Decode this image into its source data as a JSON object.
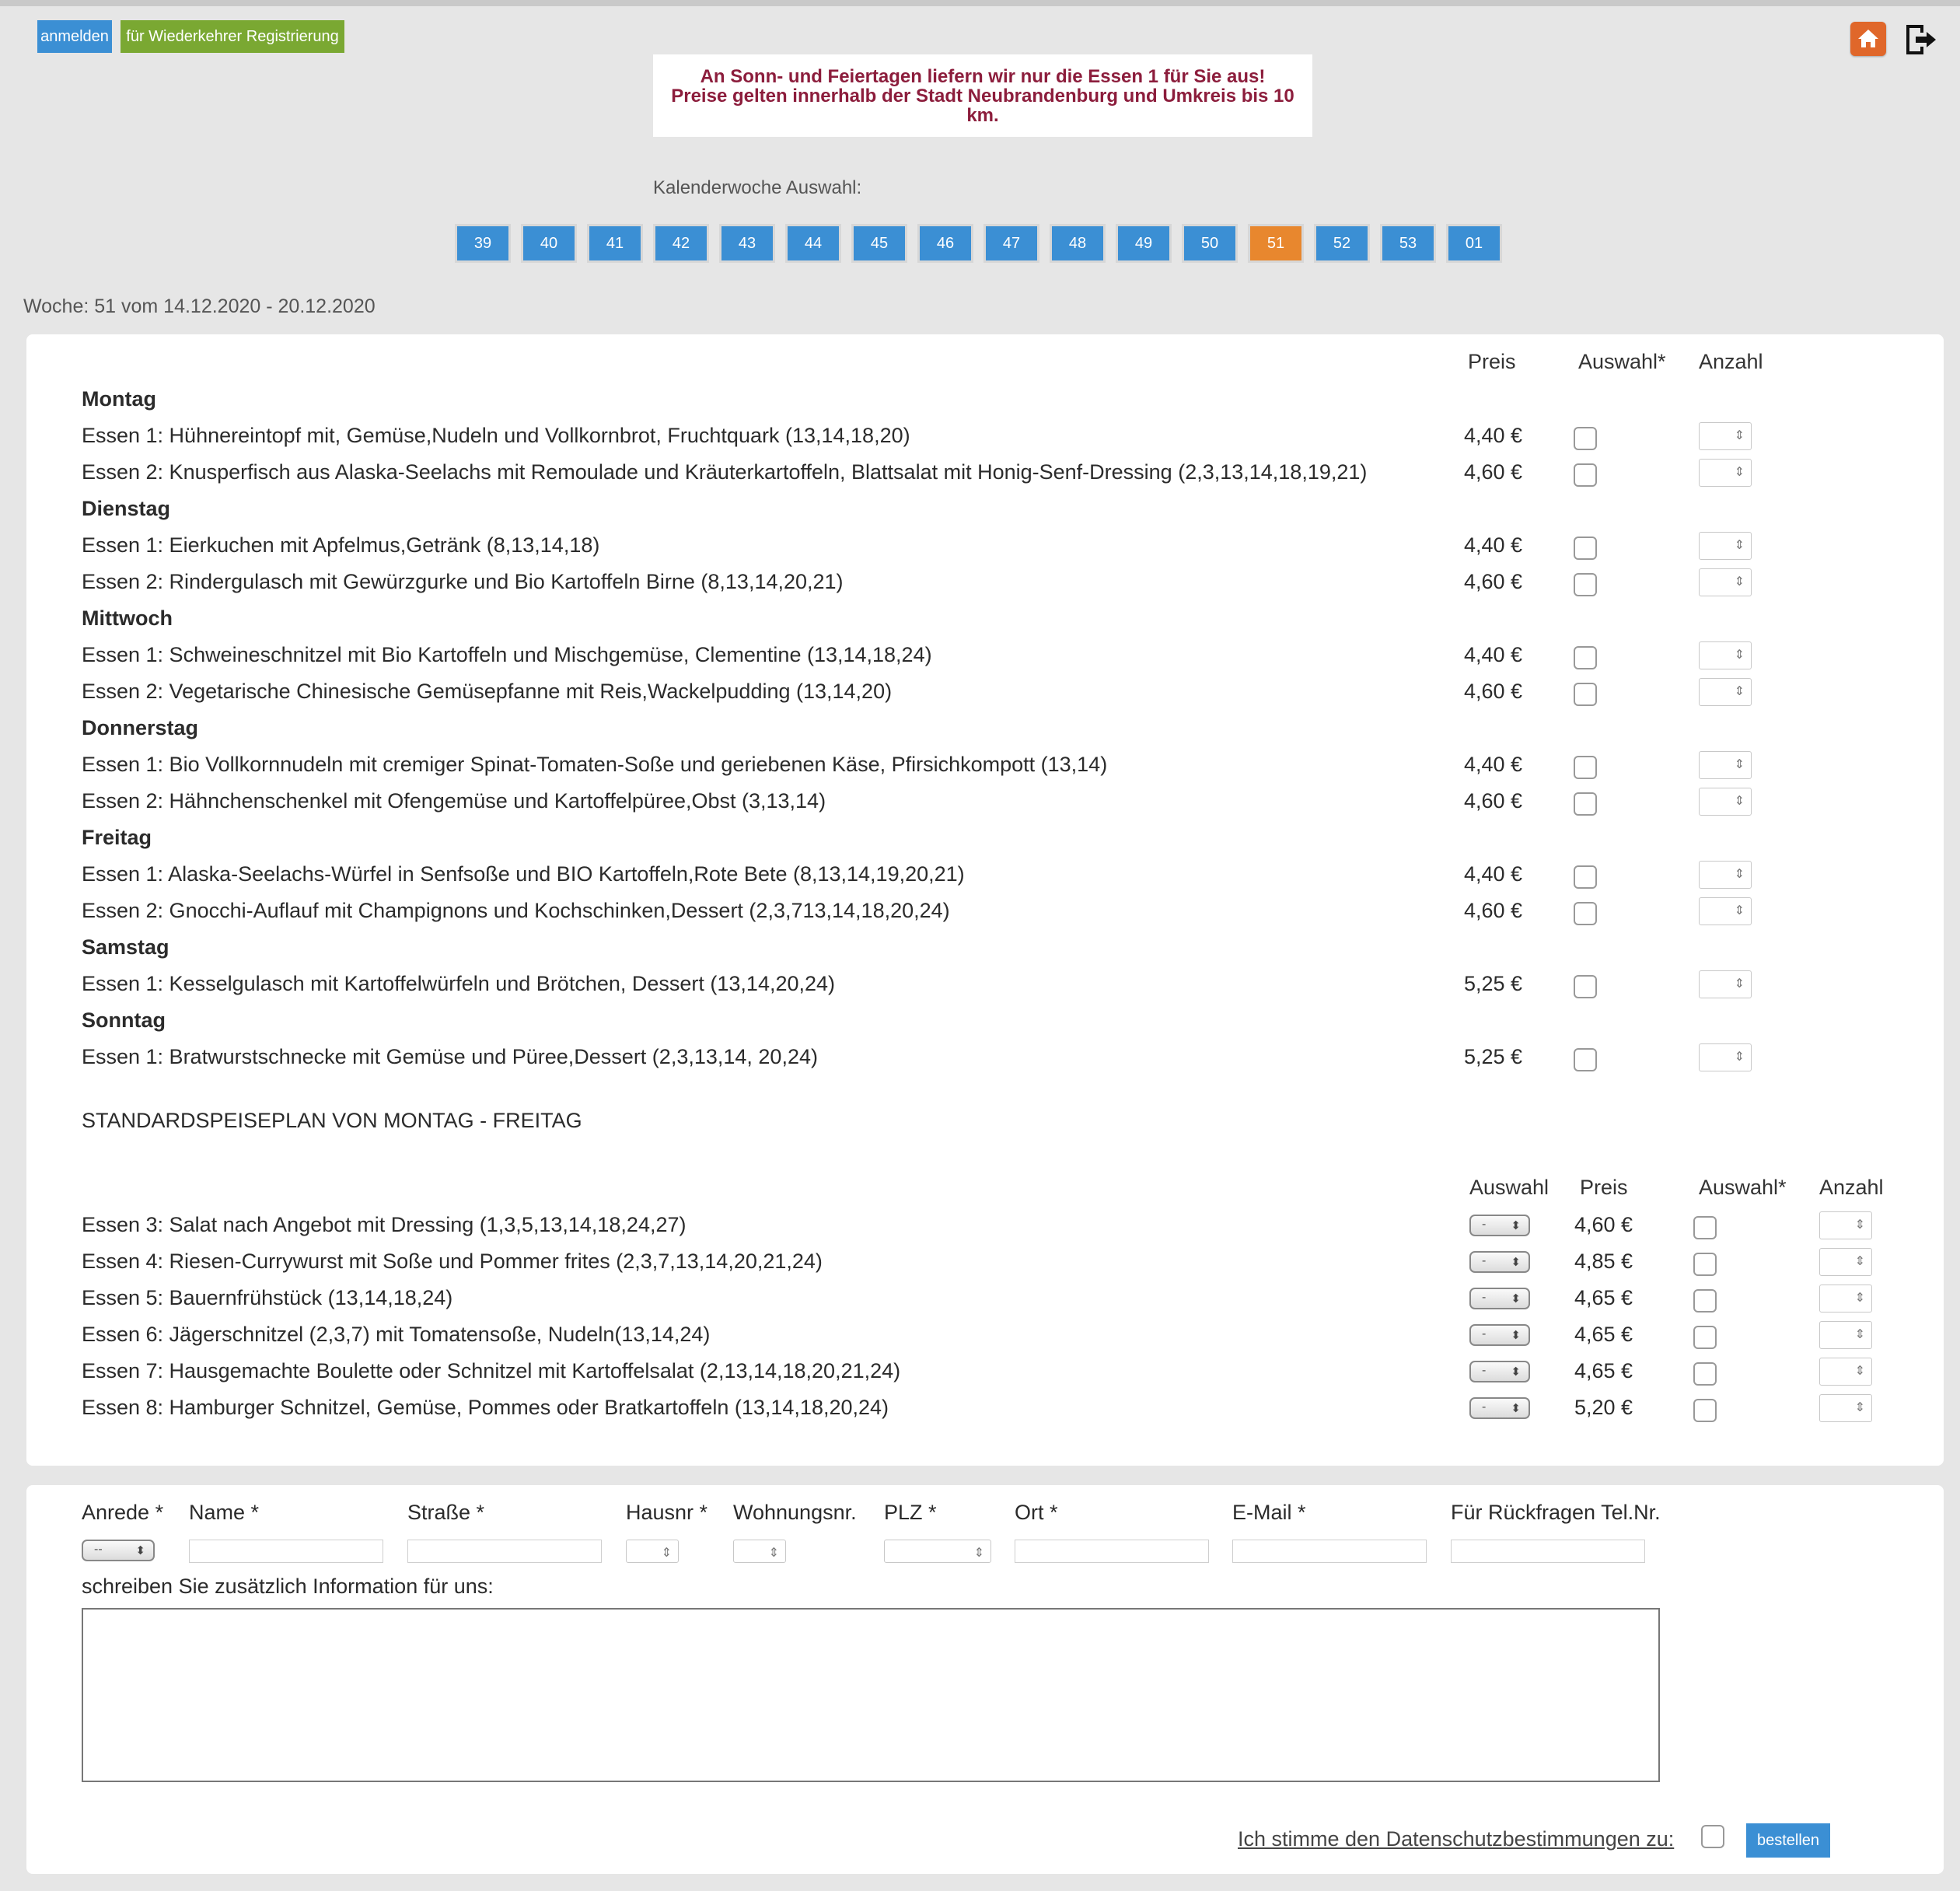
{
  "header": {
    "login_label": "anmelden",
    "register_label": "für Wiederkehrer Registrierung",
    "accent_blue": "#3b8fd4",
    "accent_green": "#7aa832",
    "home_icon": "home-icon",
    "logout_icon": "logout-icon"
  },
  "notice": {
    "line1": "An Sonn- und Feiertagen liefern wir nur die Essen 1 für Sie aus!",
    "line2": "Preise gelten innerhalb der Stadt Neubrandenburg und Umkreis bis 10",
    "line3": "km.",
    "color": "#8c1d3c"
  },
  "calendar": {
    "label": "Kalenderwoche Auswahl:",
    "weeks": [
      "39",
      "40",
      "41",
      "42",
      "43",
      "44",
      "45",
      "46",
      "47",
      "48",
      "49",
      "50",
      "51",
      "52",
      "53",
      "01"
    ],
    "active": "51",
    "active_color": "#e8872e"
  },
  "week_label": "Woche: 51 vom 14.12.2020 - 20.12.2020",
  "menu": {
    "col_preis": "Preis",
    "col_auswahl": "Auswahl*",
    "col_anzahl": "Anzahl",
    "days": [
      {
        "name": "Montag",
        "meals": [
          {
            "text": "Essen 1: Hühnereintopf mit, Gemüse,Nudeln und Vollkornbrot, Fruchtquark (13,14,18,20)",
            "price": "4,40 €"
          },
          {
            "text": "Essen 2: Knusperfisch aus Alaska-Seelachs mit Remoulade und Kräuterkartoffeln, Blattsalat mit Honig-Senf-Dressing (2,3,13,14,18,19,21)",
            "price": "4,60 €"
          }
        ]
      },
      {
        "name": "Dienstag",
        "meals": [
          {
            "text": "Essen 1: Eierkuchen mit Apfelmus,Getränk (8,13,14,18)",
            "price": "4,40 €"
          },
          {
            "text": "Essen 2: Rindergulasch mit Gewürzgurke und Bio Kartoffeln Birne (8,13,14,20,21)",
            "price": "4,60 €"
          }
        ]
      },
      {
        "name": "Mittwoch",
        "meals": [
          {
            "text": "Essen 1: Schweineschnitzel mit Bio Kartoffeln und Mischgemüse, Clementine (13,14,18,24)",
            "price": "4,40 €"
          },
          {
            "text": "Essen 2: Vegetarische Chinesische Gemüsepfanne mit Reis,Wackelpudding (13,14,20)",
            "price": "4,60 €"
          }
        ]
      },
      {
        "name": "Donnerstag",
        "meals": [
          {
            "text": "Essen 1: Bio Vollkornnudeln mit cremiger Spinat-Tomaten-Soße und geriebenen Käse, Pfirsichkompott (13,14)",
            "price": "4,40 €"
          },
          {
            "text": "Essen 2: Hähnchenschenkel mit Ofengemüse und Kartoffelpüree,Obst (3,13,14)",
            "price": "4,60 €"
          }
        ]
      },
      {
        "name": "Freitag",
        "meals": [
          {
            "text": "Essen 1: Alaska-Seelachs-Würfel in Senfsoße und BIO Kartoffeln,Rote Bete (8,13,14,19,20,21)",
            "price": "4,40 €"
          },
          {
            "text": "Essen 2: Gnocchi-Auflauf mit Champignons und Kochschinken,Dessert (2,3,713,14,18,20,24)",
            "price": "4,60 €"
          }
        ]
      },
      {
        "name": "Samstag",
        "meals": [
          {
            "text": "Essen 1: Kesselgulasch mit Kartoffelwürfeln und Brötchen, Dessert (13,14,20,24)",
            "price": "5,25 €"
          }
        ]
      },
      {
        "name": "Sonntag",
        "meals": [
          {
            "text": "Essen 1: Bratwurstschnecke mit Gemüse und Püree,Dessert (2,3,13,14, 20,24)",
            "price": "5,25 €"
          }
        ]
      }
    ]
  },
  "standard": {
    "title": "STANDARDSPEISEPLAN VON MONTAG - FREITAG",
    "col_auswahl": "Auswahl",
    "col_preis": "Preis",
    "col_auswahl2": "Auswahl*",
    "col_anzahl": "Anzahl",
    "select_value": "-",
    "items": [
      {
        "text": "Essen 3: Salat nach Angebot mit Dressing (1,3,5,13,14,18,24,27)",
        "price": "4,60 €"
      },
      {
        "text": "Essen 4: Riesen-Currywurst mit Soße und Pommer frites (2,3,7,13,14,20,21,24)",
        "price": "4,85 €"
      },
      {
        "text": "Essen 5: Bauernfrühstück (13,14,18,24)",
        "price": "4,65 €"
      },
      {
        "text": "Essen 6: Jägerschnitzel (2,3,7) mit Tomatensoße, Nudeln(13,14,24)",
        "price": "4,65 €"
      },
      {
        "text": "Essen 7: Hausgemachte Boulette oder Schnitzel mit Kartoffelsalat (2,13,14,18,20,21,24)",
        "price": "4,65 €"
      },
      {
        "text": "Essen 8: Hamburger Schnitzel, Gemüse, Pommes oder Bratkartoffeln (13,14,18,20,24)",
        "price": "5,20 €"
      }
    ]
  },
  "form": {
    "anrede_label": "Anrede *",
    "anrede_value": "--",
    "name_label": "Name *",
    "strasse_label": "Straße *",
    "hausnr_label": "Hausnr *",
    "wohnungsnr_label": "Wohnungsnr.",
    "plz_label": "PLZ *",
    "ort_label": "Ort *",
    "email_label": "E-Mail *",
    "tel_label": "Für Rückfragen Tel.Nr.",
    "info_label": "schreiben Sie zusätzlich Information für uns:",
    "privacy_label": "Ich stimme den Datenschutzbestimmungen zu:",
    "submit_label": "bestellen"
  }
}
